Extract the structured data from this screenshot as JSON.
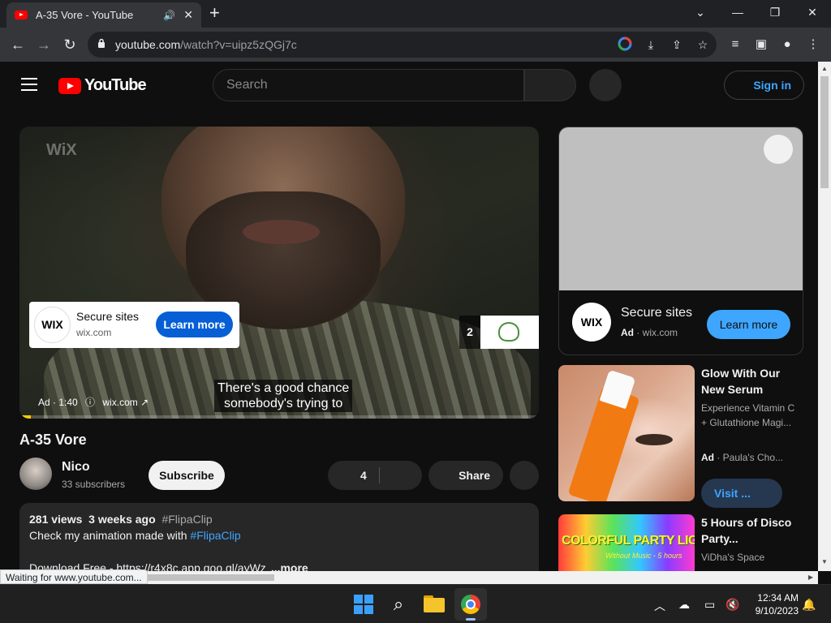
{
  "browser": {
    "tab_title": "A-35 Vore - YouTube",
    "url_host": "youtube.com",
    "url_path": "/watch?v=uipz5zQGj7c",
    "status_text": "Waiting for www.youtube.com..."
  },
  "header": {
    "logo_text": "YouTube",
    "search_placeholder": "Search",
    "signin_label": "Sign in"
  },
  "player": {
    "watermark": "WiX",
    "ad_card": {
      "logo": "WIX",
      "title": "Secure sites",
      "domain": "wix.com",
      "cta": "Learn more"
    },
    "skip_count": "2",
    "subtitle_line1": "There's a good chance",
    "subtitle_line2": "somebody's trying to",
    "ad_label": "Ad · 1:40",
    "ad_domain": "wix.com",
    "progress": 0.022
  },
  "video": {
    "title": "A-35 Vore",
    "channel": "Nico",
    "subscribers": "33 subscribers",
    "subscribe_label": "Subscribe",
    "likes": "4",
    "share_label": "Share"
  },
  "description": {
    "views": "281 views",
    "age": "3 weeks ago",
    "hashtag": "#FlipaClip",
    "line2_text": "Check my animation made with ",
    "line2_link": "#FlipaClip",
    "line3": "Download Free - https://r4x8c.app.goo.gl/ayWz",
    "more_label": "...more"
  },
  "sidebar": {
    "ad": {
      "logo": "WIX",
      "title": "Secure sites",
      "ad_badge": "Ad",
      "domain": "wix.com",
      "cta": "Learn more"
    },
    "rec1": {
      "title": "Glow With Our New Serum",
      "desc": "Experience Vitamin C + Glutathione Magi...",
      "ad_badge": "Ad",
      "advertiser": "Paula's Cho...",
      "cta": "Visit ..."
    },
    "rec2": {
      "thumb_big": "COLORFUL PARTY LIGHTS",
      "thumb_small": "Without Music - 5 hours",
      "title": "5 Hours of Disco Party...",
      "channel": "ViDha's Space"
    }
  },
  "taskbar": {
    "time": "12:34 AM",
    "date": "9/10/2023"
  },
  "colors": {
    "youtube_red": "#ff0000",
    "link_blue": "#3ea6ff",
    "cta_blue": "#065fd4",
    "ad_progress": "#ffcc00"
  }
}
